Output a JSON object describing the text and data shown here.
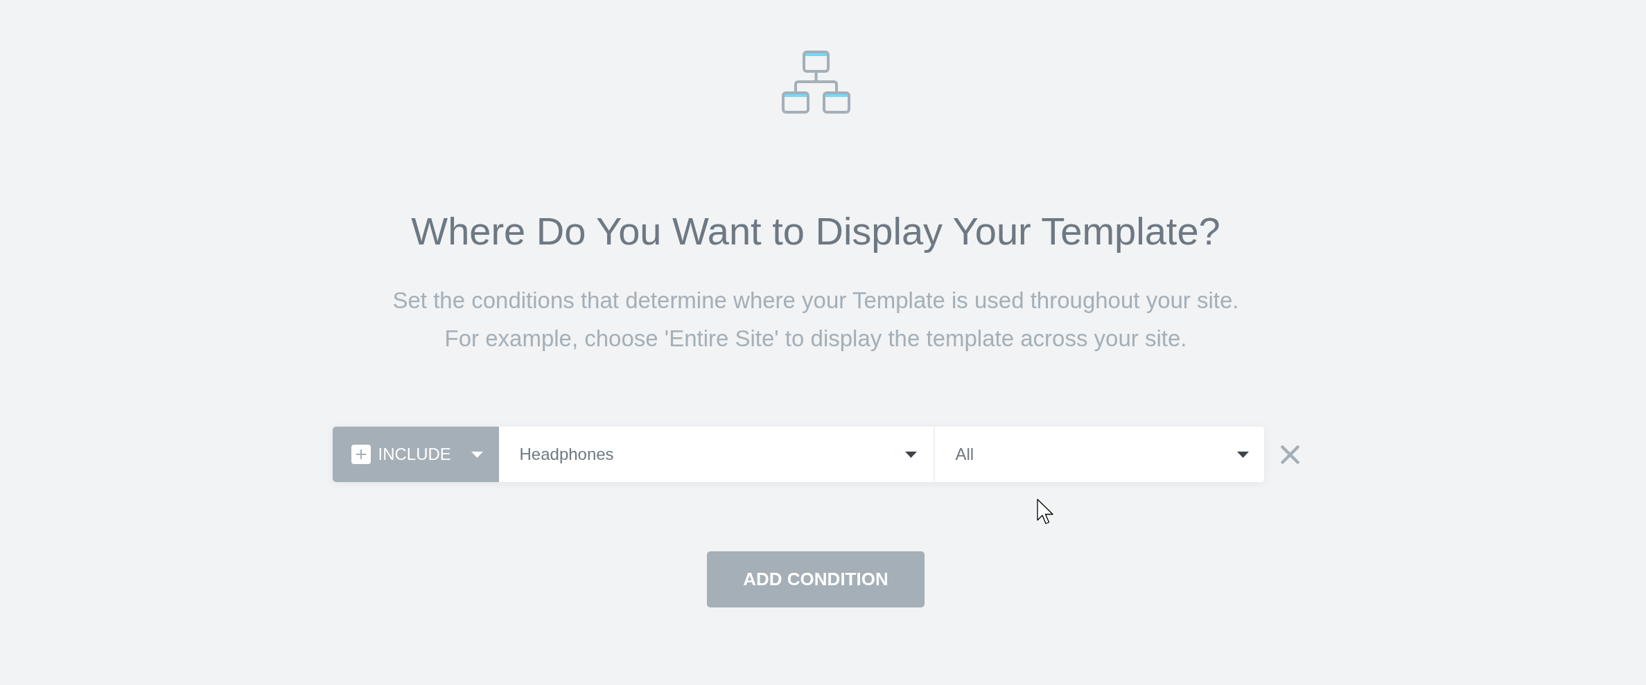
{
  "heading": "Where Do You Want to Display Your Template?",
  "description": [
    "Set the conditions that determine where your Template is used throughout your site.",
    "For example, choose 'Entire Site' to display the template across your site."
  ],
  "conditions": [
    {
      "type_label": "INCLUDE",
      "selects": [
        {
          "value": "Headphones"
        },
        {
          "value": "All"
        }
      ]
    }
  ],
  "add_button": "ADD CONDITION"
}
